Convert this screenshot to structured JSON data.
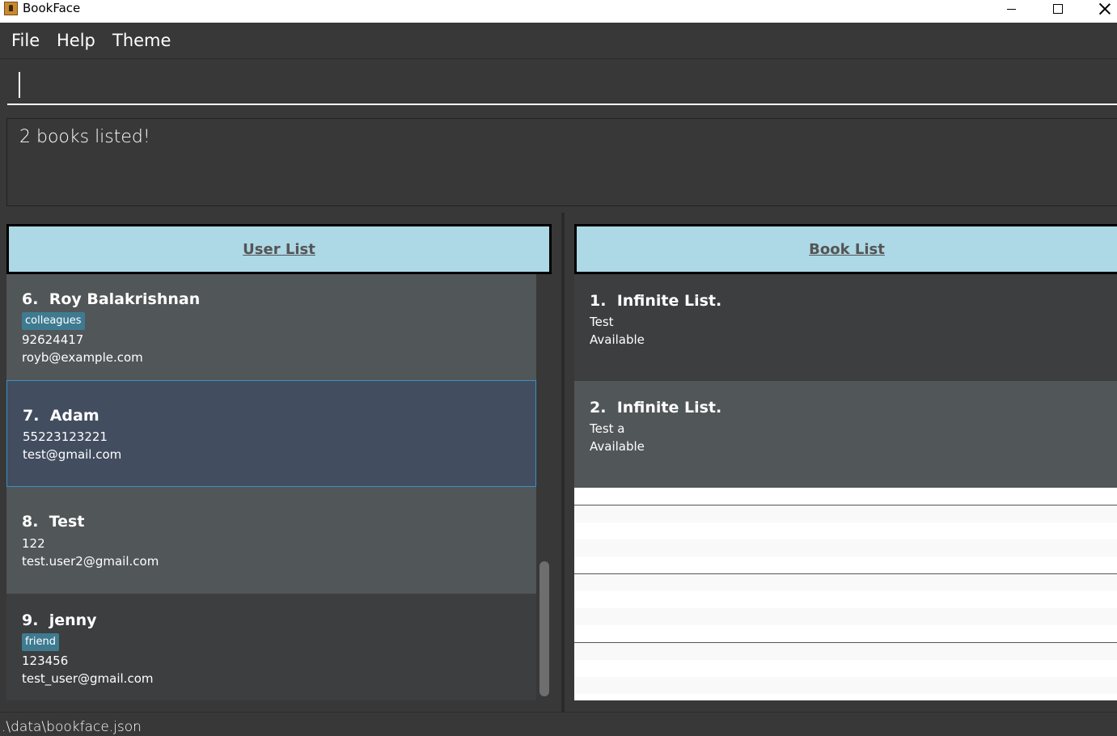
{
  "window": {
    "title": "BookFace"
  },
  "menu": {
    "file": "File",
    "help": "Help",
    "theme": "Theme"
  },
  "command": {
    "value": "",
    "placeholder": ""
  },
  "result": {
    "text": "2 books listed!"
  },
  "user_list": {
    "header": "User List",
    "users": [
      {
        "index": "6.",
        "name": "Roy Balakrishnan",
        "tag": "colleagues",
        "phone": "92624417",
        "email": "royb@example.com"
      },
      {
        "index": "7.",
        "name": "Adam",
        "phone": "55223123221",
        "email": "test@gmail.com"
      },
      {
        "index": "8.",
        "name": "Test",
        "phone": "122",
        "email": "test.user2@gmail.com"
      },
      {
        "index": "9.",
        "name": "jenny",
        "tag": "friend",
        "phone": "123456",
        "email": "test_user@gmail.com"
      }
    ]
  },
  "book_list": {
    "header": "Book List",
    "books": [
      {
        "index": "1.",
        "title": "Infinite List.",
        "author": "Test",
        "status": "Available"
      },
      {
        "index": "2.",
        "title": "Infinite List.",
        "author": "Test a",
        "status": "Available"
      }
    ]
  },
  "status_bar": {
    "path": ".\\data\\bookface.json"
  },
  "colors": {
    "header_bg": "#add8e6",
    "tag_bg": "#3e7b91",
    "selected_bg": "#424d5f",
    "selected_border": "#3d8fc6"
  }
}
